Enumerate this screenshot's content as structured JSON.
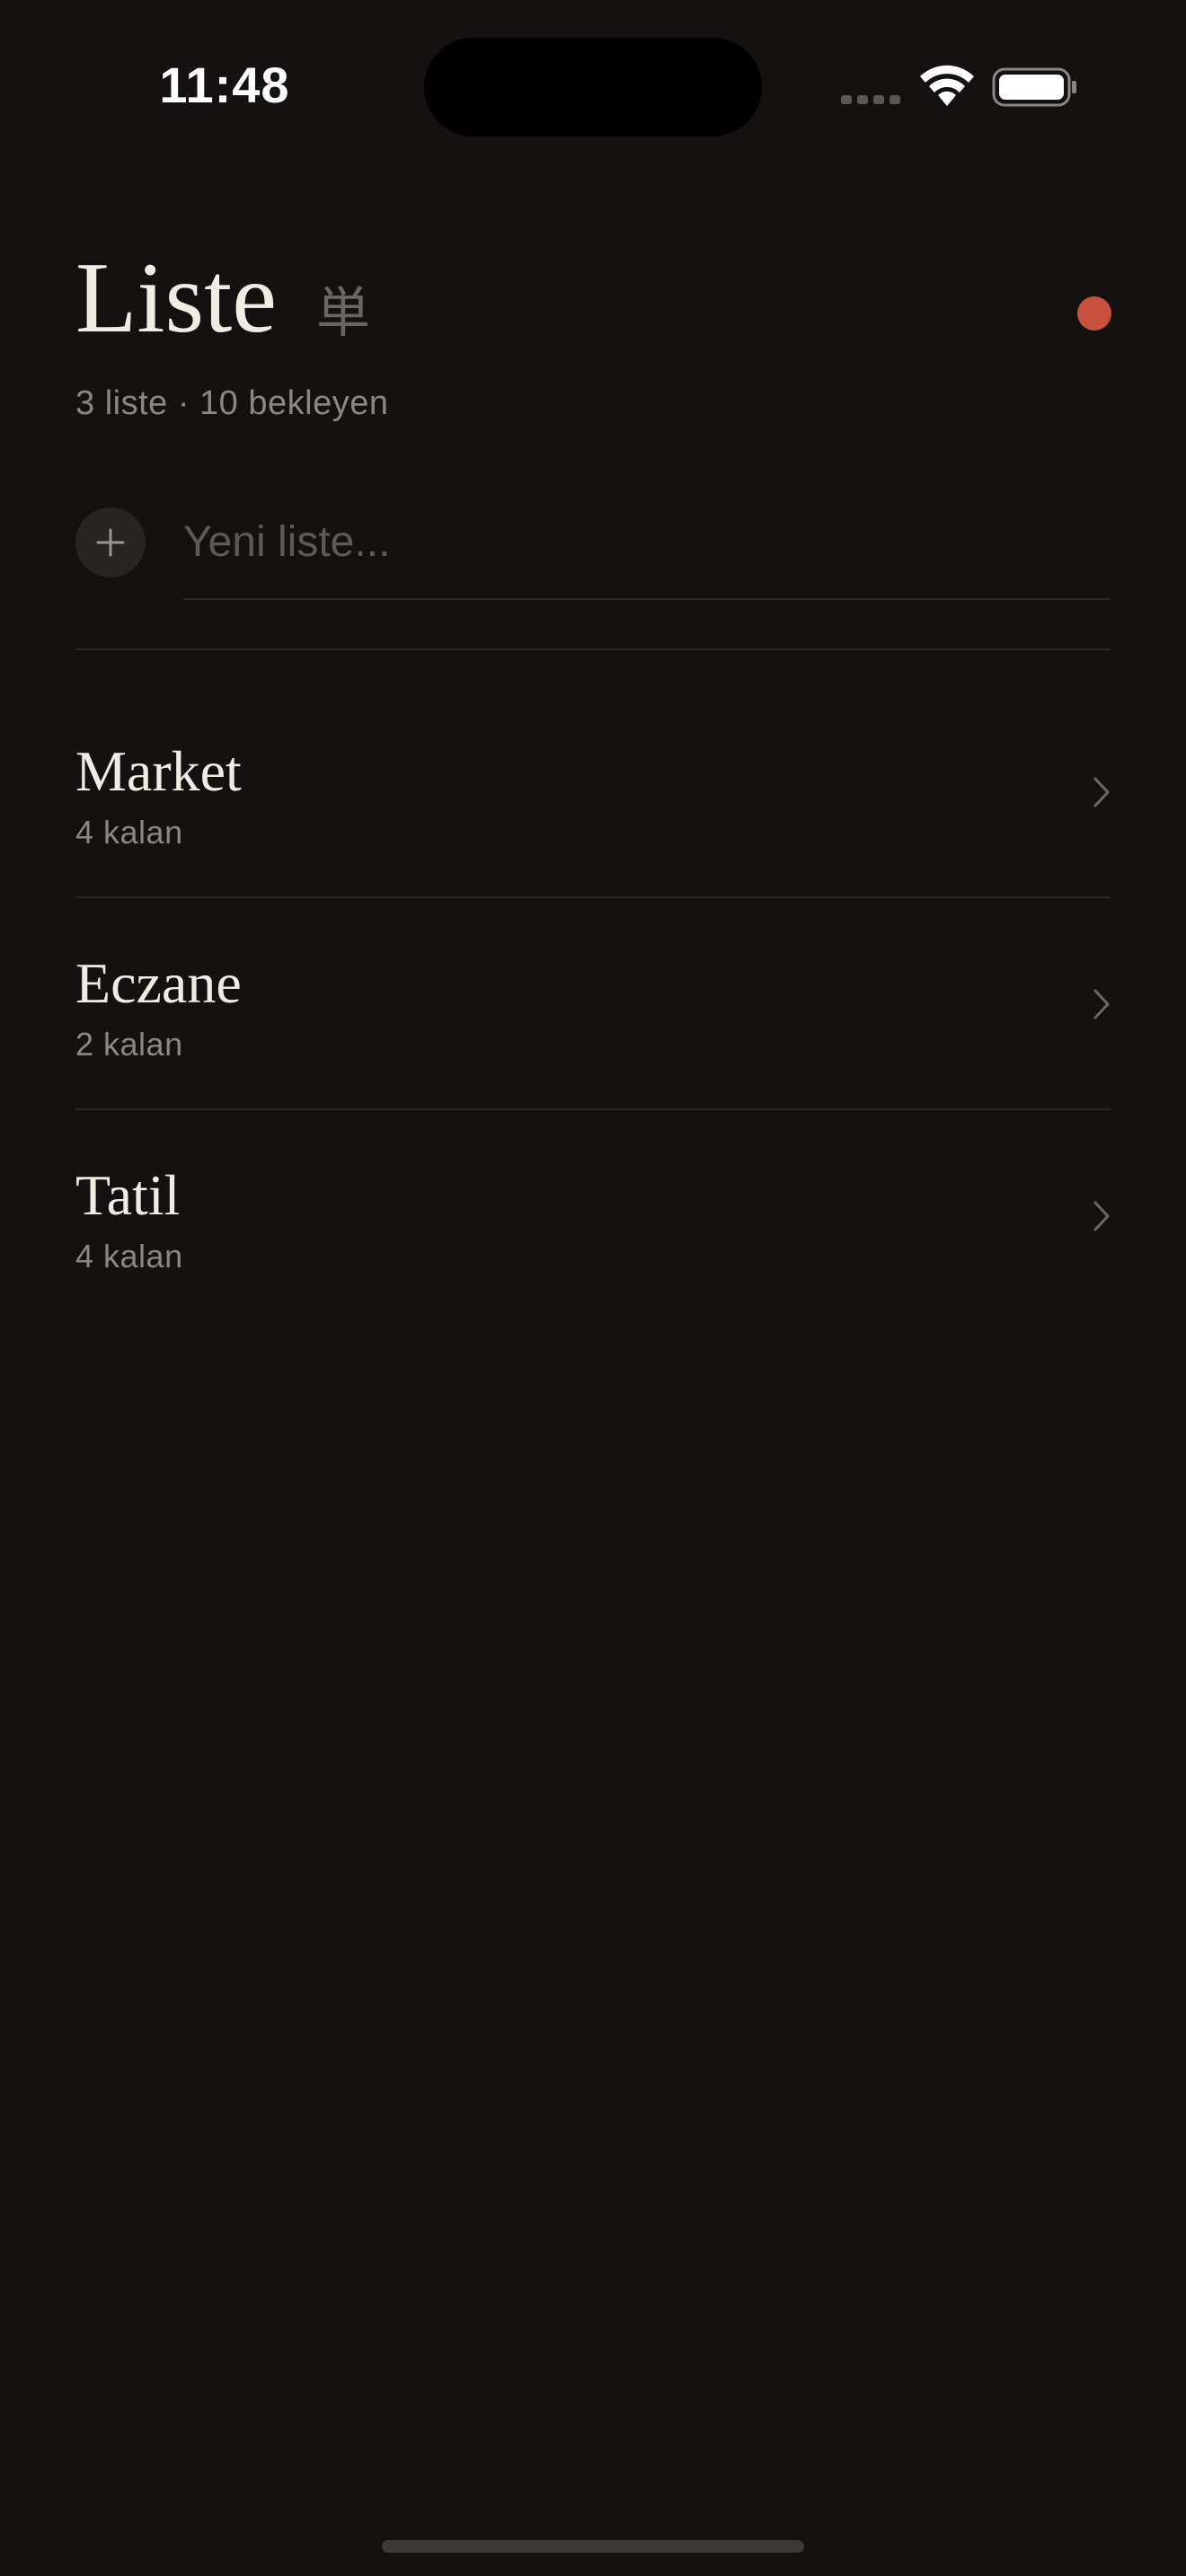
{
  "status_bar": {
    "time": "11:48"
  },
  "header": {
    "title": "Liste",
    "title_glyph": "単",
    "summary": "3 liste · 10 bekleyen",
    "status_dot_color": "#c8513e"
  },
  "new_list": {
    "placeholder": "Yeni liste..."
  },
  "lists": [
    {
      "name": "Market",
      "count": "4 kalan"
    },
    {
      "name": "Eczane",
      "count": "2 kalan"
    },
    {
      "name": "Tatil",
      "count": "4 kalan"
    }
  ],
  "icons": {
    "add": "plus-icon",
    "row_arrow": "chevron-right-icon",
    "wifi": "wifi-icon",
    "battery": "battery-icon"
  },
  "colors": {
    "background": "#141110",
    "accent": "#c8513e",
    "text_primary": "#f1ece3",
    "text_secondary": "#8d8781"
  }
}
